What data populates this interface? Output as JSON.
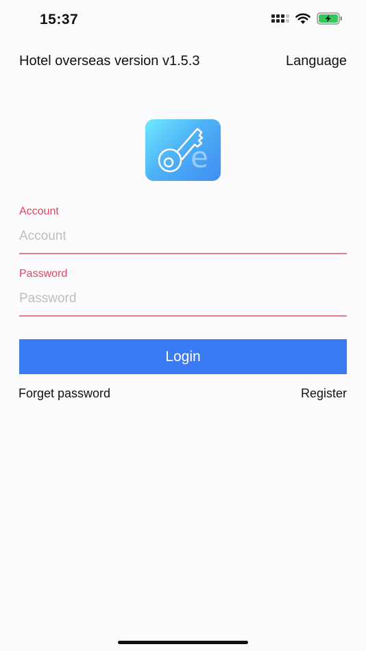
{
  "status_bar": {
    "time": "15:37",
    "icons": [
      "signal-icon",
      "wifi-icon",
      "battery-charging-icon"
    ],
    "battery_color": "#34c759"
  },
  "header": {
    "title": "Hotel overseas version v1.5.3",
    "language_label": "Language"
  },
  "logo": {
    "icon": "key-e-app-logo",
    "gradient": [
      "#6fe9ff",
      "#3f8df0"
    ]
  },
  "form": {
    "account": {
      "label": "Account",
      "placeholder": "Account",
      "value": ""
    },
    "password": {
      "label": "Password",
      "placeholder": "Password",
      "value": ""
    },
    "accent_color": "#e0455e"
  },
  "actions": {
    "login_label": "Login",
    "login_color": "#3a7af2",
    "forget_password_label": "Forget password",
    "register_label": "Register"
  }
}
